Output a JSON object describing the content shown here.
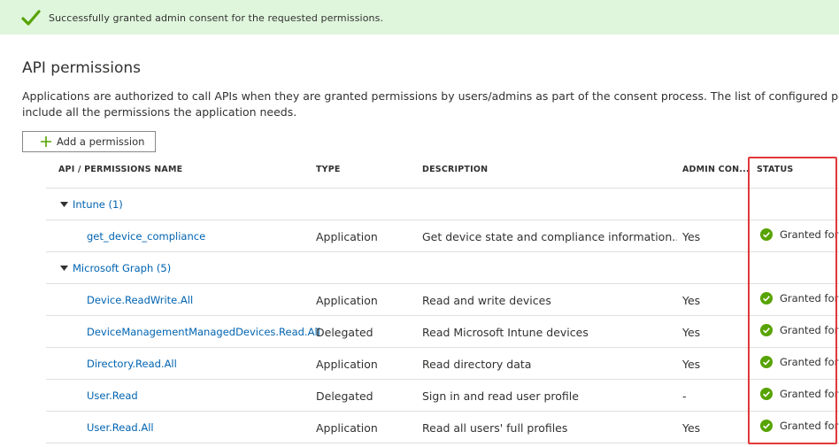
{
  "banner": {
    "message": "Successfully granted admin consent for the requested permissions.",
    "icon": "checkmark-icon",
    "color": "#dff6dd"
  },
  "page": {
    "title": "API permissions",
    "description_line1": "Applications are authorized to call APIs when they are granted permissions by users/admins as part of the consent process. The list of configured permissions",
    "description_line2": "include all the permissions the application needs."
  },
  "toolbar": {
    "add_label": "Add a permission"
  },
  "table": {
    "headers": {
      "name": "API / PERMISSIONS NAME",
      "type": "TYPE",
      "description": "DESCRIPTION",
      "admin": "ADMIN CON...",
      "status": "STATUS"
    },
    "groups": [
      {
        "label": "Intune (1)"
      },
      {
        "label": "Microsoft Graph (5)"
      }
    ],
    "rows": [
      {
        "name": "get_device_compliance",
        "type": "Application",
        "description": "Get device state and compliance information...",
        "admin": "Yes",
        "status": "Granted for"
      },
      {
        "name": "Device.ReadWrite.All",
        "type": "Application",
        "description": "Read and write devices",
        "admin": "Yes",
        "status": "Granted for"
      },
      {
        "name": "DeviceManagementManagedDevices.Read.All",
        "type": "Delegated",
        "description": "Read Microsoft Intune devices",
        "admin": "Yes",
        "status": "Granted for"
      },
      {
        "name": "Directory.Read.All",
        "type": "Application",
        "description": "Read directory data",
        "admin": "Yes",
        "status": "Granted for"
      },
      {
        "name": "User.Read",
        "type": "Delegated",
        "description": "Sign in and read user profile",
        "admin": "-",
        "status": "Granted for"
      },
      {
        "name": "User.Read.All",
        "type": "Application",
        "description": "Read all users' full profiles",
        "admin": "Yes",
        "status": "Granted for"
      }
    ]
  },
  "colors": {
    "link": "#0063b1",
    "success": "#57a300",
    "highlight": "#e2383a"
  }
}
